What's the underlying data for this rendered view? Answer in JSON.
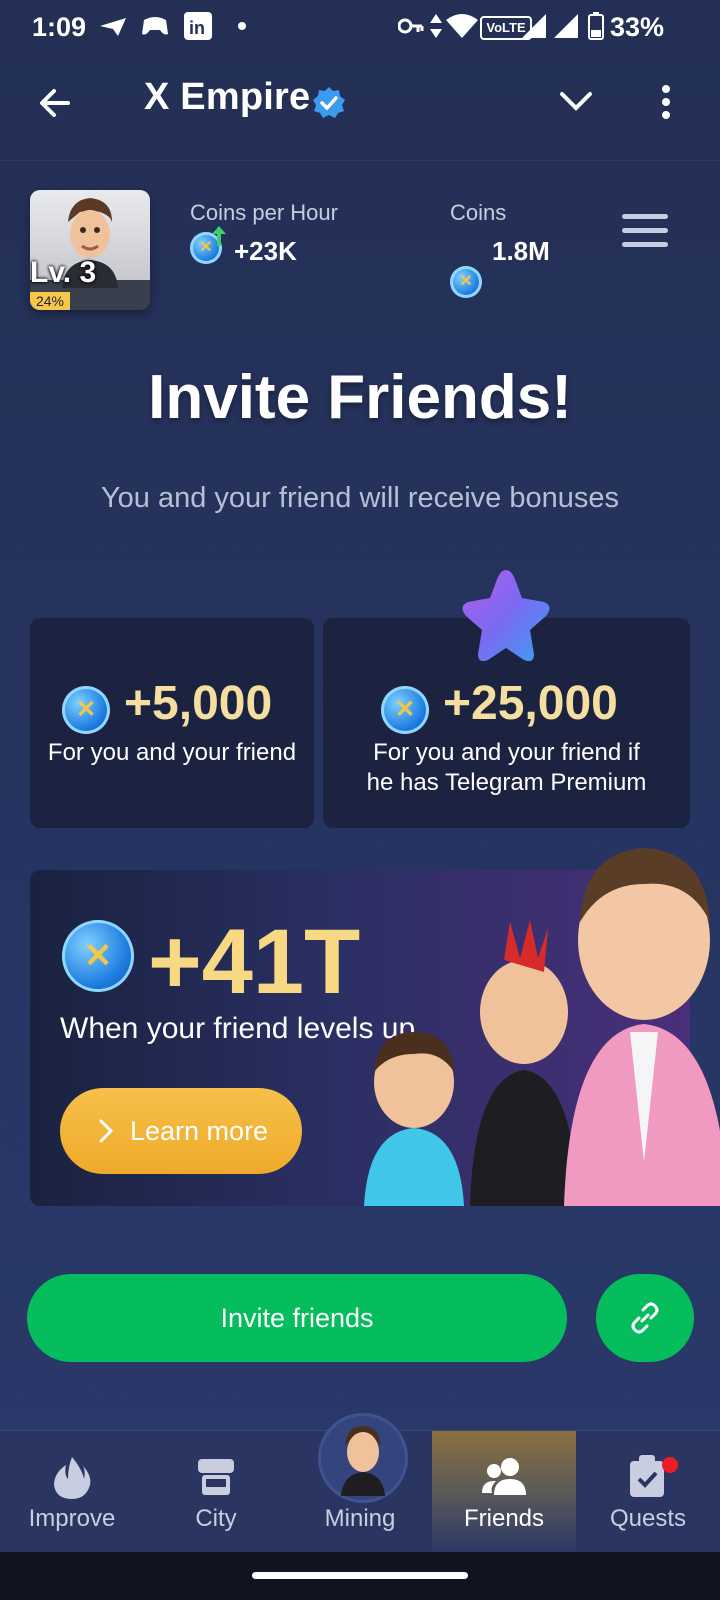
{
  "status_bar": {
    "time": "1:09",
    "battery": "33%"
  },
  "titlebar": {
    "title": "X Empire"
  },
  "profile": {
    "level": "Lv. 3",
    "level_progress": "24%",
    "coins_per_hour_label": "Coins per Hour",
    "coins_per_hour_value": "+23K",
    "coins_label": "Coins",
    "coins_value": "1.8M"
  },
  "hero": {
    "title": "Invite Friends!",
    "subtitle": "You and your friend will receive bonuses"
  },
  "cards": [
    {
      "amount": "+5,000",
      "desc": "For you and your friend"
    },
    {
      "amount": "+25,000",
      "desc_line1": "For you and your friend if",
      "desc_line2": "he has Telegram Premium"
    }
  ],
  "promo": {
    "amount": "+41T",
    "desc": "When your friend levels up.",
    "button": "Learn more"
  },
  "actions": {
    "invite_label": "Invite friends"
  },
  "nav": [
    {
      "label": "Improve",
      "icon": "flame-icon"
    },
    {
      "label": "City",
      "icon": "store-icon"
    },
    {
      "label": "Mining",
      "icon": "avatar"
    },
    {
      "label": "Friends",
      "icon": "friends-icon",
      "active": true
    },
    {
      "label": "Quests",
      "icon": "clipboard-check-icon",
      "badge": true
    }
  ],
  "colors": {
    "accent_green": "#05bd5c",
    "gold": "#f5dfa0",
    "background": "#273563",
    "button_orange": "#f0b030"
  }
}
